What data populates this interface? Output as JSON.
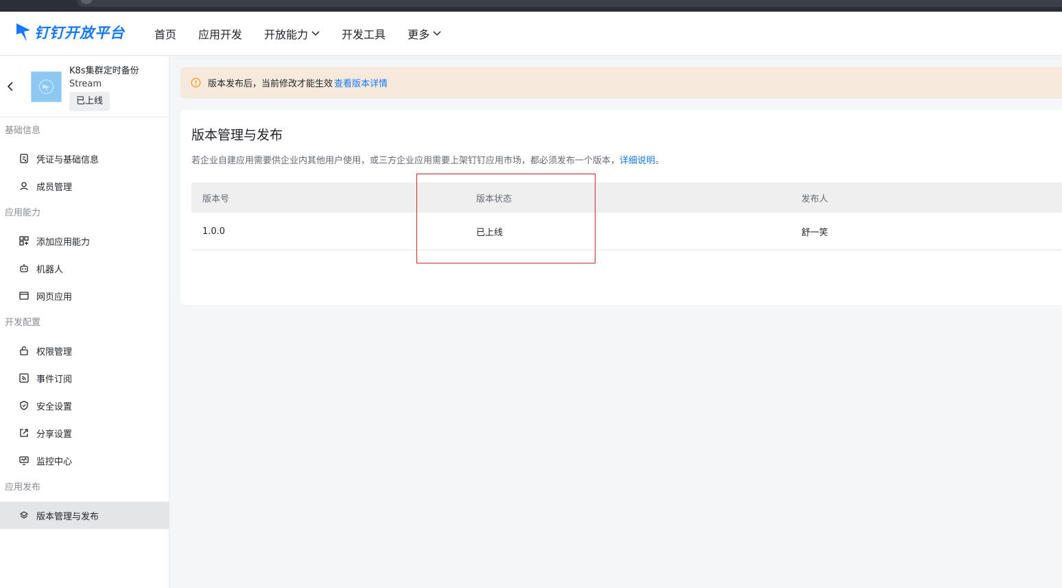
{
  "header": {
    "logo_text": "钉钉开放平台",
    "nav": [
      {
        "label": "首页",
        "has_dropdown": false
      },
      {
        "label": "应用开发",
        "has_dropdown": false
      },
      {
        "label": "开放能力",
        "has_dropdown": true
      },
      {
        "label": "开发工具",
        "has_dropdown": false
      },
      {
        "label": "更多",
        "has_dropdown": true
      }
    ]
  },
  "sidebar": {
    "app": {
      "name": "K8s集群定时备份",
      "type": "Stream",
      "status": "已上线"
    },
    "groups": [
      {
        "title": "基础信息",
        "items": [
          {
            "label": "凭证与基础信息",
            "icon": "credential-icon"
          },
          {
            "label": "成员管理",
            "icon": "user-icon"
          }
        ]
      },
      {
        "title": "应用能力",
        "items": [
          {
            "label": "添加应用能力",
            "icon": "grid-add-icon"
          },
          {
            "label": "机器人",
            "icon": "robot-icon"
          },
          {
            "label": "网页应用",
            "icon": "browser-window-icon"
          }
        ]
      },
      {
        "title": "开发配置",
        "items": [
          {
            "label": "权限管理",
            "icon": "lock-icon"
          },
          {
            "label": "事件订阅",
            "icon": "rss-icon"
          },
          {
            "label": "安全设置",
            "icon": "shield-icon"
          },
          {
            "label": "分享设置",
            "icon": "share-icon"
          },
          {
            "label": "监控中心",
            "icon": "monitor-icon"
          }
        ]
      },
      {
        "title": "应用发布",
        "items": [
          {
            "label": "版本管理与发布",
            "icon": "layers-icon",
            "active": true
          }
        ]
      }
    ]
  },
  "notice": {
    "text": "版本发布后，当前修改才能生效",
    "link": "查看版本详情"
  },
  "card": {
    "title": "版本管理与发布",
    "desc_prefix": "若企业自建应用需要供企业内其他用户使用，或三方企业应用需要上架钉钉应用市场，都必须发布一个版本，",
    "desc_link": "详细说明",
    "desc_suffix": "。",
    "columns": [
      "版本号",
      "版本状态",
      "发布人"
    ],
    "rows": [
      [
        "1.0.0",
        "已上线",
        "舒一笑"
      ]
    ]
  },
  "colors": {
    "accent": "#1677ff",
    "notice_bg": "#f5eadb",
    "highlight": "#c8262b"
  }
}
